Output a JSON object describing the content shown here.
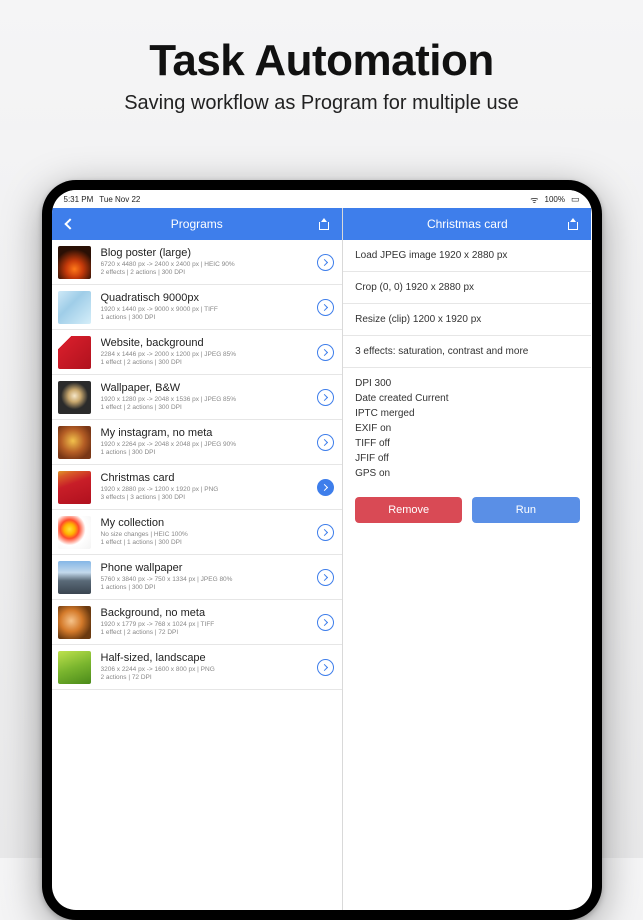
{
  "hero": {
    "title": "Task Automation",
    "subtitle": "Saving workflow as Program for multiple use"
  },
  "statusbar": {
    "time": "5:31 PM",
    "date": "Tue Nov 22",
    "battery": "100%"
  },
  "leftNav": {
    "title": "Programs"
  },
  "rightNav": {
    "title": "Christmas card"
  },
  "programs": [
    {
      "title": "Blog poster (large)",
      "sub": "6720 x 4480 px -> 2400 x 2400 px | HEIC 90%\n2 effects | 2 actions | 300 DPI"
    },
    {
      "title": "Quadratisch 9000px",
      "sub": "1920 x 1440 px -> 9000 x 9000 px | TIFF\n1 actions | 300 DPI"
    },
    {
      "title": "Website, background",
      "sub": "2284 x 1446 px -> 2000 x 1200 px | JPEG 85%\n1 effect | 2 actions | 300 DPI"
    },
    {
      "title": "Wallpaper, B&W",
      "sub": "1920 x 1280 px -> 2048 x 1536 px | JPEG 85%\n1 effect | 2 actions | 300 DPI"
    },
    {
      "title": "My instagram, no meta",
      "sub": "1920 x 2264 px -> 2048 x 2048 px | JPEG 90%\n1 actions | 300 DPI"
    },
    {
      "title": "Christmas card",
      "sub": "1920 x 2880 px -> 1200 x 1920 px | PNG\n3 effects | 3 actions | 300 DPI",
      "selected": true
    },
    {
      "title": "My collection",
      "sub": "No size changes | HEIC 100%\n1 effect | 1 actions | 300 DPI"
    },
    {
      "title": "Phone wallpaper",
      "sub": "5760 x 3840 px -> 750 x 1334 px | JPEG 80%\n1 actions | 300 DPI"
    },
    {
      "title": "Background, no meta",
      "sub": "1920 x 1779 px -> 768 x 1024 px | TIFF\n1 effect | 2 actions | 72 DPI"
    },
    {
      "title": "Half-sized, landscape",
      "sub": "3206 x 2244 px -> 1600 x 800 px | PNG\n2 actions | 72 DPI"
    }
  ],
  "detail": {
    "steps": [
      "Load JPEG image 1920 x 2880 px",
      "Crop (0, 0) 1920 x 2880 px",
      "Resize (clip) 1200 x 1920 px",
      "3 effects: saturation, contrast and more"
    ],
    "meta": [
      "DPI 300",
      "Date created Current",
      "IPTC merged",
      "EXIF on",
      "TIFF off",
      "JFIF off",
      "GPS on"
    ],
    "removeLabel": "Remove",
    "runLabel": "Run"
  }
}
